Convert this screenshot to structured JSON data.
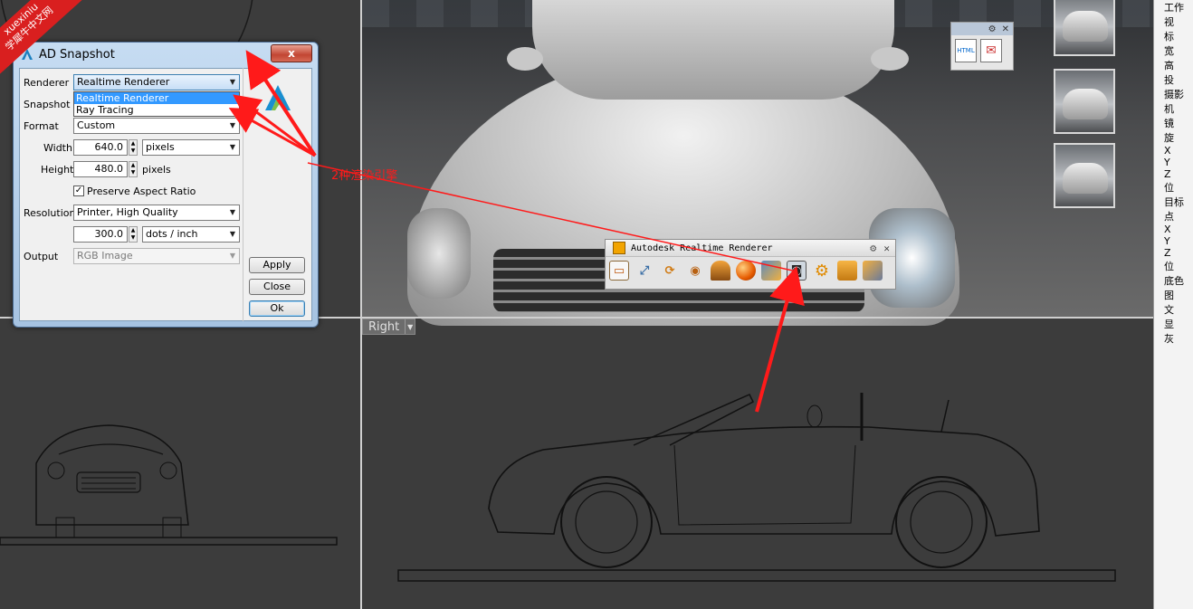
{
  "watermark": {
    "line1": "xuexiniu",
    "line2": "学犀牛中文网"
  },
  "viewport": {
    "right_label": "Right"
  },
  "mini_widget": {
    "icon_label": "HTML"
  },
  "renderer_toolbar": {
    "title": "Autodesk Realtime Renderer",
    "tools": [
      "viewport-icon",
      "zoom-extents-icon",
      "refresh-icon",
      "eye-icon",
      "material-icon",
      "sphere-icon",
      "environment-icon",
      "snapshot-camera-icon",
      "settings-gear-icon",
      "toolbox-icon",
      "render-tools-icon"
    ]
  },
  "dialog": {
    "title": "AD Snapshot",
    "close_glyph": "x",
    "renderer_label": "Renderer",
    "renderer_value": "Realtime Renderer",
    "renderer_options": [
      "Realtime Renderer",
      "Ray Tracing"
    ],
    "snapshot_label": "Snapshot",
    "format_label": "Format",
    "format_value": "Custom",
    "width_label": "Width",
    "width_value": "640.0",
    "width_unit": "pixels",
    "height_label": "Height",
    "height_value": "480.0",
    "height_unit": "pixels",
    "preserve_label": "Preserve Aspect Ratio",
    "resolution_label": "Resolution",
    "resolution_value": "Printer, High Quality",
    "dpi_value": "300.0",
    "dpi_unit": "dots / inch",
    "output_label": "Output",
    "output_value": "RGB Image",
    "apply_label": "Apply",
    "close_label": "Close",
    "ok_label": "Ok"
  },
  "annotation": {
    "text": "2种渲染引擎"
  },
  "props_panel": {
    "rows": [
      "工作视",
      "标",
      "宽",
      "高",
      "投",
      "摄影机",
      "镜",
      "旋",
      "X",
      "Y",
      "Z",
      "位",
      "目标点",
      "X",
      "Y",
      "Z",
      "位",
      "底色图",
      "文",
      "显",
      "灰"
    ]
  },
  "colors": {
    "annotation": "#ff1a1a",
    "dialog_frame": "#a6c3e2",
    "selection": "#3399ff"
  }
}
